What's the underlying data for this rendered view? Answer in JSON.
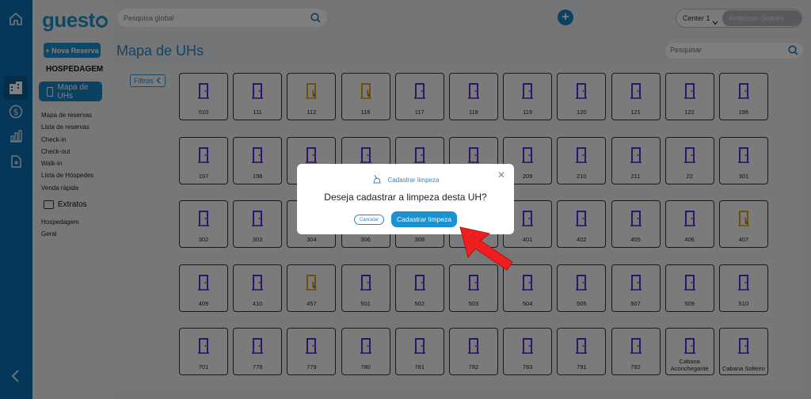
{
  "app": {
    "logo": "guest"
  },
  "nav_rail": [
    {
      "name": "home-icon"
    },
    {
      "name": "building-icon",
      "active": true
    },
    {
      "name": "dollar-icon"
    },
    {
      "name": "bar-chart-icon"
    },
    {
      "name": "document-icon"
    },
    {
      "name": "chevron-left-icon"
    }
  ],
  "sidebar": {
    "new_booking": "+ Nova Reserva",
    "section_title": "HOSPEDAGEM",
    "active_item": "Mapa de UHs",
    "links": [
      "Mapa de reservas",
      "Lista de reservas",
      "Check-in",
      "Check-out",
      "Walk-in",
      "Lista de Hóspedes",
      "Venda rápida"
    ],
    "extratos_label": "Extratos",
    "extratos_links": [
      "Hospedagem",
      "Geral"
    ]
  },
  "topbar": {
    "search_placeholder": "Pesquisa global",
    "center": "Center 1",
    "user": "Anderson Soares"
  },
  "page": {
    "title": "Mapa de UHs",
    "search_placeholder": "Pesquisar",
    "filters_label": "Filtros"
  },
  "colors": {
    "primary": "#1a92cf",
    "door_free": "#5b2bd6",
    "door_dirty": "#d6a21a"
  },
  "rooms": [
    {
      "number": "010",
      "status": "free"
    },
    {
      "number": "111",
      "status": "free"
    },
    {
      "number": "112",
      "status": "dirty"
    },
    {
      "number": "116",
      "status": "dirty"
    },
    {
      "number": "117",
      "status": "free"
    },
    {
      "number": "118",
      "status": "free"
    },
    {
      "number": "119",
      "status": "free"
    },
    {
      "number": "120",
      "status": "free"
    },
    {
      "number": "121",
      "status": "free"
    },
    {
      "number": "122",
      "status": "free"
    },
    {
      "number": "196",
      "status": "free"
    },
    {
      "number": "197",
      "status": "free"
    },
    {
      "number": "198",
      "status": "free"
    },
    {
      "number": "",
      "status": "free"
    },
    {
      "number": "",
      "status": "free"
    },
    {
      "number": "",
      "status": "free"
    },
    {
      "number": "",
      "status": "free"
    },
    {
      "number": "209",
      "status": "free"
    },
    {
      "number": "210",
      "status": "free"
    },
    {
      "number": "211",
      "status": "free"
    },
    {
      "number": "22",
      "status": "free"
    },
    {
      "number": "301",
      "status": "free"
    },
    {
      "number": "302",
      "status": "free"
    },
    {
      "number": "303",
      "status": "free"
    },
    {
      "number": "304",
      "status": "free"
    },
    {
      "number": "306",
      "status": "free"
    },
    {
      "number": "308",
      "status": "free"
    },
    {
      "number": "",
      "status": "free"
    },
    {
      "number": "401",
      "status": "free"
    },
    {
      "number": "402",
      "status": "free"
    },
    {
      "number": "405",
      "status": "free"
    },
    {
      "number": "406",
      "status": "free"
    },
    {
      "number": "407",
      "status": "dirty"
    },
    {
      "number": "409",
      "status": "free"
    },
    {
      "number": "410",
      "status": "free"
    },
    {
      "number": "457",
      "status": "dirty"
    },
    {
      "number": "501",
      "status": "free"
    },
    {
      "number": "502",
      "status": "free"
    },
    {
      "number": "503",
      "status": "free"
    },
    {
      "number": "504",
      "status": "free"
    },
    {
      "number": "505",
      "status": "free"
    },
    {
      "number": "507",
      "status": "free"
    },
    {
      "number": "509",
      "status": "free"
    },
    {
      "number": "510",
      "status": "free"
    },
    {
      "number": "701",
      "status": "free"
    },
    {
      "number": "778",
      "status": "free"
    },
    {
      "number": "779",
      "status": "free"
    },
    {
      "number": "780",
      "status": "free"
    },
    {
      "number": "781",
      "status": "free"
    },
    {
      "number": "782",
      "status": "free"
    },
    {
      "number": "783",
      "status": "free"
    },
    {
      "number": "791",
      "status": "free"
    },
    {
      "number": "792",
      "status": "free"
    },
    {
      "number": "Cabana Aconchegante",
      "status": "free"
    },
    {
      "number": "Cabana Solteiro",
      "status": "free"
    }
  ],
  "modal": {
    "title": "Cadastrar limpeza",
    "question": "Deseja cadastrar a limpeza desta UH?",
    "cancel_label": "Cancelar",
    "confirm_label": "Cadastrar limpeza"
  }
}
